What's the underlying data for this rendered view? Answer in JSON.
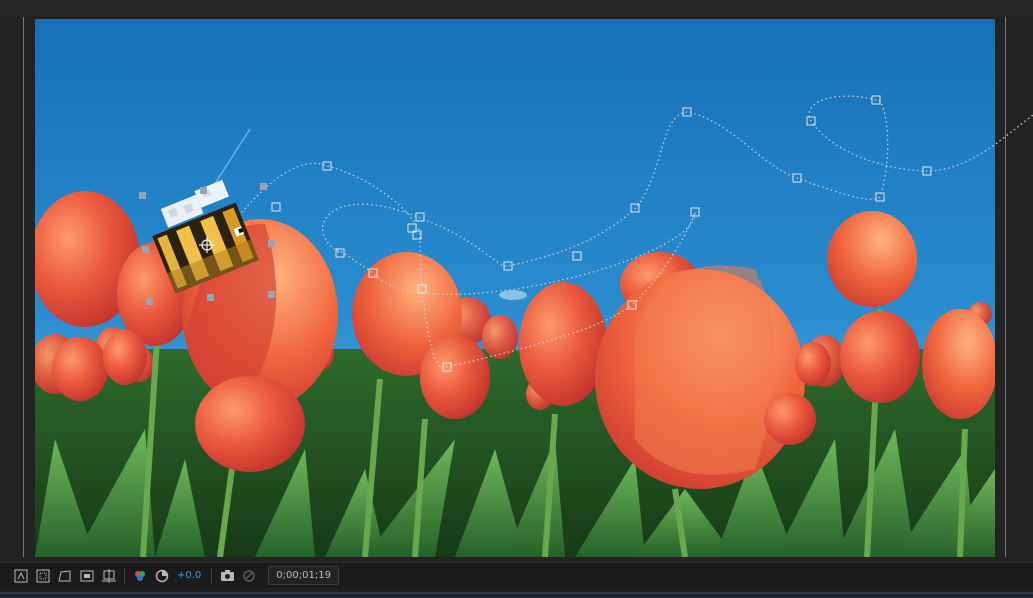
{
  "viewer": {
    "timecode": "0;00;01;19",
    "exposure_value": "+0.0"
  },
  "toolbar": {
    "buttons": [
      {
        "name": "always-preview-icon",
        "interactable": true
      },
      {
        "name": "region-of-interest-icon",
        "interactable": true
      },
      {
        "name": "transparency-grid-icon",
        "interactable": true
      },
      {
        "name": "mask-visibility-icon",
        "interactable": true
      },
      {
        "name": "guides-grid-icon",
        "interactable": true
      },
      {
        "name": "show-channel-icon",
        "interactable": true
      },
      {
        "name": "reset-exposure-icon",
        "interactable": true
      },
      {
        "name": "snapshot-camera-icon",
        "interactable": true
      },
      {
        "name": "show-snapshot-icon",
        "interactable": false
      }
    ]
  },
  "colors": {
    "sky_top": "#1772b8",
    "sky_bottom": "#3aa0dc",
    "tulip_red": "#e8473a",
    "tulip_orange": "#f07a3a",
    "leaf_green": "#3f8f3a",
    "motion_path": "#c8ccd8",
    "exposure_blue": "#3f9ae6"
  }
}
